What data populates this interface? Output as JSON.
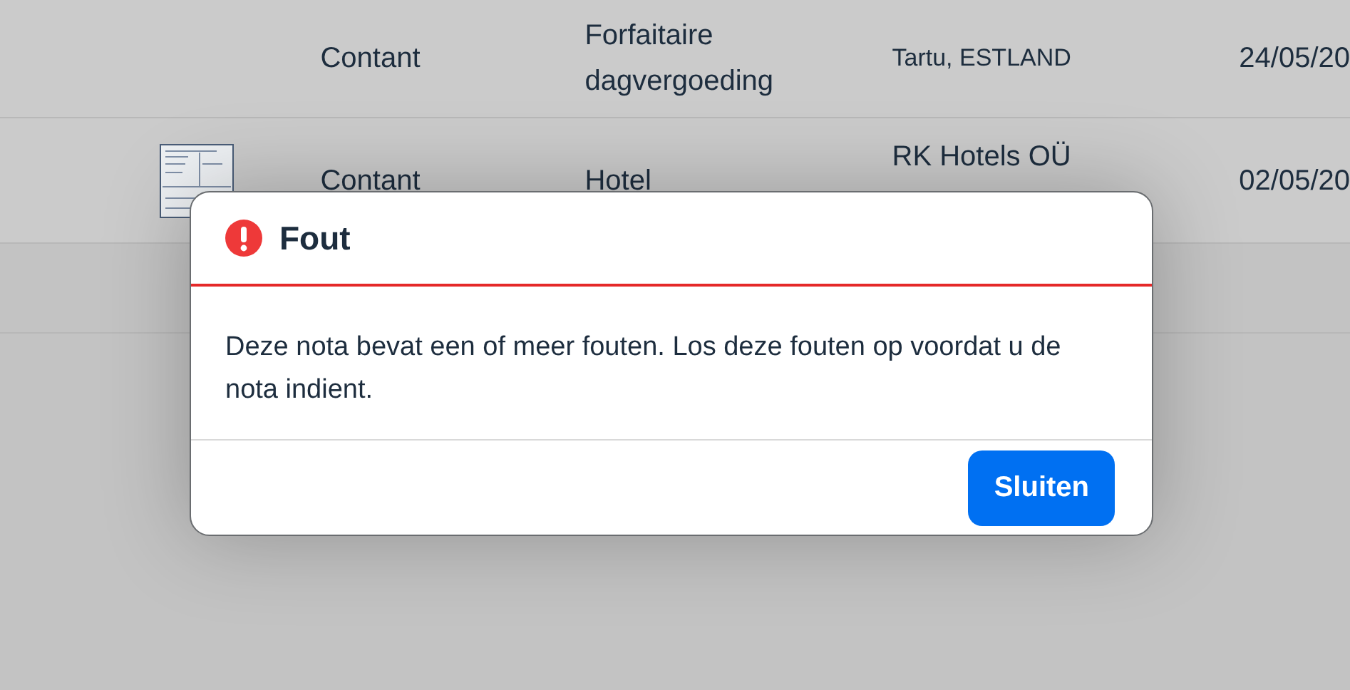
{
  "table": {
    "rows": [
      {
        "receipt": false,
        "payment": "Contant",
        "type": "Forfaitaire dagvergoeding",
        "location": "Tartu, ESTLAND",
        "date": "24/05/20"
      },
      {
        "receipt": true,
        "payment": "Contant",
        "type": "Hotel",
        "location": "RK Hotels OÜ",
        "date": "02/05/20"
      }
    ]
  },
  "dialog": {
    "title": "Fout",
    "message": "Deze nota bevat een of meer fouten. Los deze fouten op voordat u de nota indient.",
    "button": "Sluiten"
  }
}
